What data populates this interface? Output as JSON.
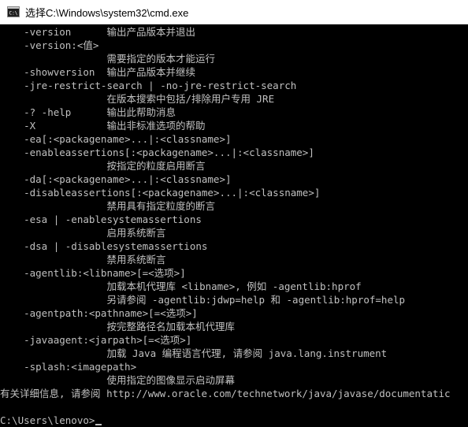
{
  "window": {
    "title": "选择C:\\Windows\\system32\\cmd.exe"
  },
  "console": {
    "lines": [
      "    -version      输出产品版本并退出",
      "    -version:<值>",
      "                  需要指定的版本才能运行",
      "    -showversion  输出产品版本并继续",
      "    -jre-restrict-search | -no-jre-restrict-search",
      "                  在版本搜索中包括/排除用户专用 JRE",
      "    -? -help      输出此帮助消息",
      "    -X            输出非标准选项的帮助",
      "    -ea[:<packagename>...|:<classname>]",
      "    -enableassertions[:<packagename>...|:<classname>]",
      "                  按指定的粒度启用断言",
      "    -da[:<packagename>...|:<classname>]",
      "    -disableassertions[:<packagename>...|:<classname>]",
      "                  禁用具有指定粒度的断言",
      "    -esa | -enablesystemassertions",
      "                  启用系统断言",
      "    -dsa | -disablesystemassertions",
      "                  禁用系统断言",
      "    -agentlib:<libname>[=<选项>]",
      "                  加载本机代理库 <libname>, 例如 -agentlib:hprof",
      "                  另请参阅 -agentlib:jdwp=help 和 -agentlib:hprof=help",
      "    -agentpath:<pathname>[=<选项>]",
      "                  按完整路径名加载本机代理库",
      "    -javaagent:<jarpath>[=<选项>]",
      "                  加载 Java 编程语言代理, 请参阅 java.lang.instrument",
      "    -splash:<imagepath>",
      "                  使用指定的图像显示启动屏幕",
      "有关详细信息, 请参阅 http://www.oracle.com/technetwork/java/javase/documentatic",
      "",
      "C:\\Users\\lenovo>"
    ]
  },
  "colors": {
    "console_background": "#000000",
    "console_text": "#c0c0c0",
    "titlebar_background": "#ffffff"
  },
  "icons": {
    "title_icon": "cmd-icon"
  }
}
